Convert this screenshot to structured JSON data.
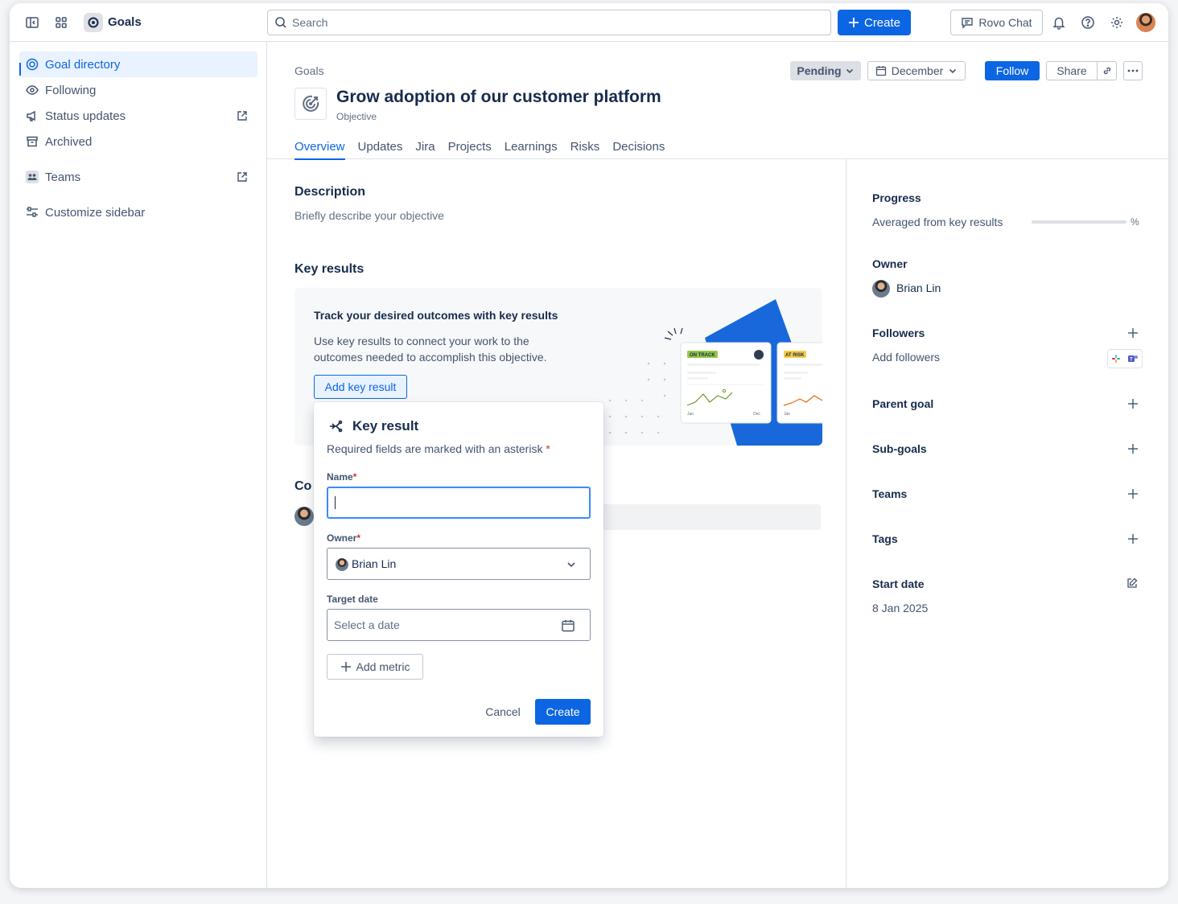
{
  "topnav": {
    "app_name": "Goals",
    "search_placeholder": "Search",
    "create_label": "Create",
    "rovo_label": "Rovo Chat"
  },
  "sidebar": {
    "items": [
      {
        "label": "Goal directory",
        "icon": "target-icon"
      },
      {
        "label": "Following",
        "icon": "eye-icon"
      },
      {
        "label": "Status updates",
        "icon": "megaphone-icon"
      },
      {
        "label": "Archived",
        "icon": "archive-icon"
      },
      {
        "label": "Teams",
        "icon": "teams-icon"
      },
      {
        "label": "Customize sidebar",
        "icon": "customize-icon"
      }
    ]
  },
  "header": {
    "breadcrumb": "Goals",
    "title": "Grow adoption of our customer platform",
    "type": "Objective",
    "status": "Pending",
    "month": "December",
    "follow_label": "Follow",
    "share_label": "Share",
    "tabs": [
      "Overview",
      "Updates",
      "Jira",
      "Projects",
      "Learnings",
      "Risks",
      "Decisions"
    ]
  },
  "main": {
    "description_heading": "Description",
    "description_placeholder": "Briefly describe your objective",
    "key_results_heading": "Key results",
    "kr_card_title": "Track your desired outcomes with key results",
    "kr_card_text": "Use key results to connect your work to the outcomes needed to accomplish this objective.",
    "add_kr_label": "Add key result",
    "comments_heading": "Comments",
    "illustration": {
      "on_track": "ON TRACK",
      "at_risk": "AT RISK",
      "jan": "Jan",
      "dec": "Dec"
    }
  },
  "popup": {
    "title": "Key result",
    "subtitle": "Required fields are marked with an asterisk",
    "asterisk": "*",
    "name_label": "Name",
    "owner_label": "Owner",
    "owner_value": "Brian Lin",
    "target_date_label": "Target date",
    "date_placeholder": "Select a date",
    "add_metric_label": "Add metric",
    "cancel_label": "Cancel",
    "create_label": "Create"
  },
  "right": {
    "progress_heading": "Progress",
    "progress_text": "Averaged from key results",
    "progress_pct": "%",
    "owner_heading": "Owner",
    "owner_name": "Brian Lin",
    "followers_heading": "Followers",
    "add_followers": "Add followers",
    "parent_goal_heading": "Parent goal",
    "sub_goals_heading": "Sub-goals",
    "teams_heading": "Teams",
    "tags_heading": "Tags",
    "start_date_heading": "Start date",
    "start_date_value": "8 Jan 2025"
  },
  "colors": {
    "brand_blue": "#0c66e4",
    "on_track": "#94c748",
    "at_risk": "#f5cd47"
  }
}
